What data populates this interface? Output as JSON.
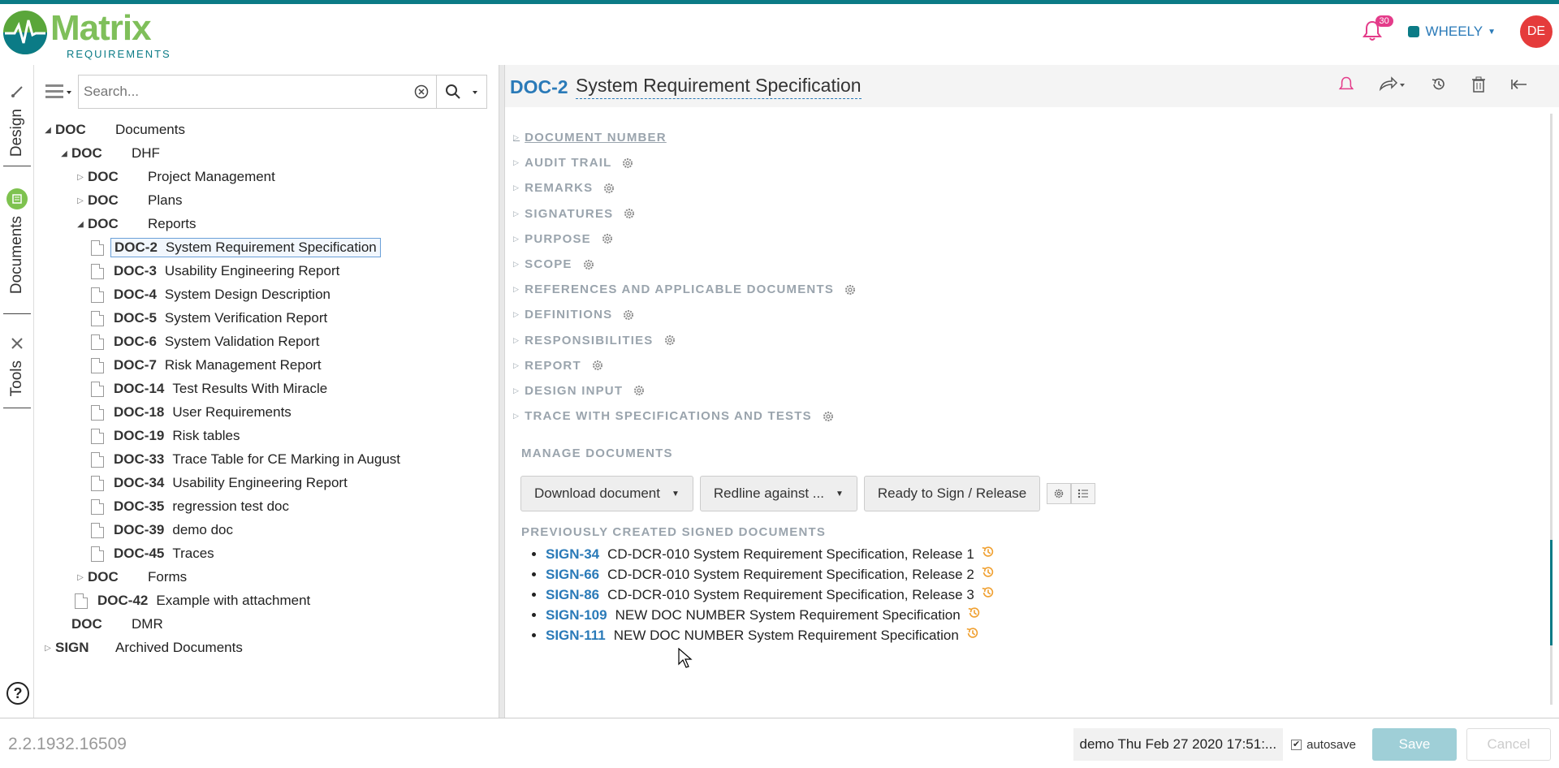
{
  "header": {
    "logo_word": "Matrix",
    "logo_sub": "REQUIREMENTS",
    "notification_count": "30",
    "project": "WHEELY",
    "avatar": "DE"
  },
  "sidebar": {
    "tabs": [
      {
        "label": "Design",
        "icon": "brush-icon"
      },
      {
        "label": "Documents",
        "icon": "documents-icon"
      },
      {
        "label": "Tools",
        "icon": "tools-icon"
      }
    ],
    "help": "?"
  },
  "tree": {
    "search_placeholder": "Search...",
    "nodes": [
      {
        "code": "DOC",
        "label": "Documents"
      },
      {
        "code": "DOC",
        "label": "DHF"
      },
      {
        "code": "DOC",
        "label": "Project Management"
      },
      {
        "code": "DOC",
        "label": "Plans"
      },
      {
        "code": "DOC",
        "label": "Reports"
      },
      {
        "code": "DOC-2",
        "label": "System Requirement Specification"
      },
      {
        "code": "DOC-3",
        "label": "Usability Engineering Report"
      },
      {
        "code": "DOC-4",
        "label": "System Design Description"
      },
      {
        "code": "DOC-5",
        "label": "System Verification Report"
      },
      {
        "code": "DOC-6",
        "label": "System Validation Report"
      },
      {
        "code": "DOC-7",
        "label": "Risk Management Report"
      },
      {
        "code": "DOC-14",
        "label": "Test Results With Miracle"
      },
      {
        "code": "DOC-18",
        "label": "User Requirements"
      },
      {
        "code": "DOC-19",
        "label": "Risk tables"
      },
      {
        "code": "DOC-33",
        "label": "Trace Table for CE Marking in August"
      },
      {
        "code": "DOC-34",
        "label": "Usability Engineering Report"
      },
      {
        "code": "DOC-35",
        "label": "regression test doc"
      },
      {
        "code": "DOC-39",
        "label": "demo doc"
      },
      {
        "code": "DOC-45",
        "label": "Traces"
      },
      {
        "code": "DOC",
        "label": "Forms"
      },
      {
        "code": "DOC-42",
        "label": "Example with attachment"
      },
      {
        "code": "DOC",
        "label": "DMR"
      },
      {
        "code": "SIGN",
        "label": "Archived Documents"
      }
    ]
  },
  "main": {
    "doc_id": "DOC-2",
    "doc_title": "System Requirement Specification",
    "sections": [
      "DOCUMENT NUMBER",
      "AUDIT TRAIL",
      "REMARKS",
      "SIGNATURES",
      "PURPOSE",
      "SCOPE",
      "REFERENCES AND APPLICABLE DOCUMENTS",
      "DEFINITIONS",
      "RESPONSIBILITIES",
      "REPORT",
      "DESIGN INPUT",
      "TRACE WITH SPECIFICATIONS AND TESTS"
    ],
    "manage_label": "MANAGE DOCUMENTS",
    "buttons": {
      "download": "Download document",
      "redline": "Redline against ...",
      "ready": "Ready to Sign / Release"
    },
    "prev_label": "PREVIOUSLY CREATED SIGNED DOCUMENTS",
    "signed": [
      {
        "id": "SIGN-34",
        "title": "CD-DCR-010 System Requirement Specification, Release 1"
      },
      {
        "id": "SIGN-66",
        "title": "CD-DCR-010 System Requirement Specification, Release 2"
      },
      {
        "id": "SIGN-86",
        "title": "CD-DCR-010 System Requirement Specification, Release 3"
      },
      {
        "id": "SIGN-109",
        "title": "NEW DOC NUMBER System Requirement Specification"
      },
      {
        "id": "SIGN-111",
        "title": "NEW DOC NUMBER System Requirement Specification"
      }
    ]
  },
  "footer": {
    "version": "2.2.1932.16509",
    "status": "demo Thu Feb 27 2020 17:51:...",
    "autosave": "autosave",
    "save": "Save",
    "cancel": "Cancel"
  },
  "colors": {
    "brand_teal": "#0b7b86",
    "brand_green": "#7fbf5a",
    "link_blue": "#2a7ab8",
    "avatar_red": "#e53b3b",
    "history_orange": "#f0a030"
  }
}
